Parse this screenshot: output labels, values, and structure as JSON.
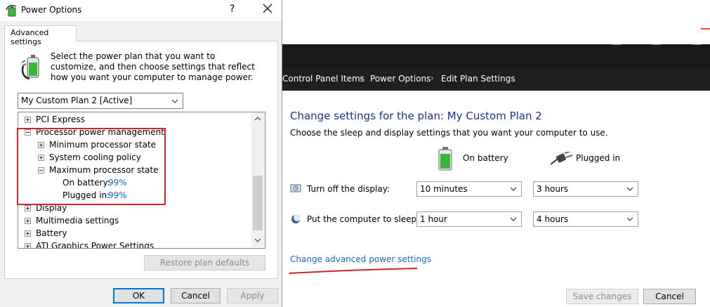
{
  "background_window": {
    "breadcrumb": [
      "Control Panel Items",
      "Power Options",
      "Edit Plan Settings"
    ],
    "heading": "Change settings for the plan: My Custom Plan 2",
    "subtitle": "Choose the sleep and display settings that you want your computer to use.",
    "columns": {
      "on_battery": "On battery",
      "plugged_in": "Plugged in"
    },
    "rows": [
      {
        "label": "Turn off the display:",
        "icon": "display-icon",
        "on_battery": "10 minutes",
        "plugged_in": "3 hours"
      },
      {
        "label": "Put the computer to sleep:",
        "icon": "moon-icon",
        "on_battery": "1 hour",
        "plugged_in": "4 hours"
      }
    ],
    "advanced_link": "Change advanced power settings",
    "buttons": {
      "save": "Save changes",
      "cancel": "Cancel"
    },
    "accent_link_color": "#1e64c8",
    "heading_color": "#1e3287"
  },
  "dialog": {
    "title": "Power Options",
    "help": "?",
    "tab": "Advanced settings",
    "intro": "Select the power plan that you want to customize, and then choose settings that reflect how you want your computer to manage power.",
    "plan_select": "My Custom Plan 2 [Active]",
    "tree": [
      {
        "label": "PCI Express",
        "expander": "plus"
      },
      {
        "label": "Processor power management",
        "expander": "minus"
      },
      {
        "label": "Minimum processor state",
        "expander": "plus"
      },
      {
        "label": "System cooling policy",
        "expander": "plus"
      },
      {
        "label": "Maximum processor state",
        "expander": "minus"
      },
      {
        "label": "On battery:",
        "value": "99%"
      },
      {
        "label": "Plugged in:",
        "value": "99%"
      },
      {
        "label": "Display",
        "expander": "plus"
      },
      {
        "label": "Multimedia settings",
        "expander": "plus"
      },
      {
        "label": "Battery",
        "expander": "plus"
      },
      {
        "label": "ATI Graphics Power Settings",
        "expander": "plus"
      }
    ],
    "restore_button": "Restore plan defaults",
    "buttons": {
      "ok": "OK",
      "cancel": "Cancel",
      "apply": "Apply"
    },
    "highlight_color": "#d2232a"
  }
}
